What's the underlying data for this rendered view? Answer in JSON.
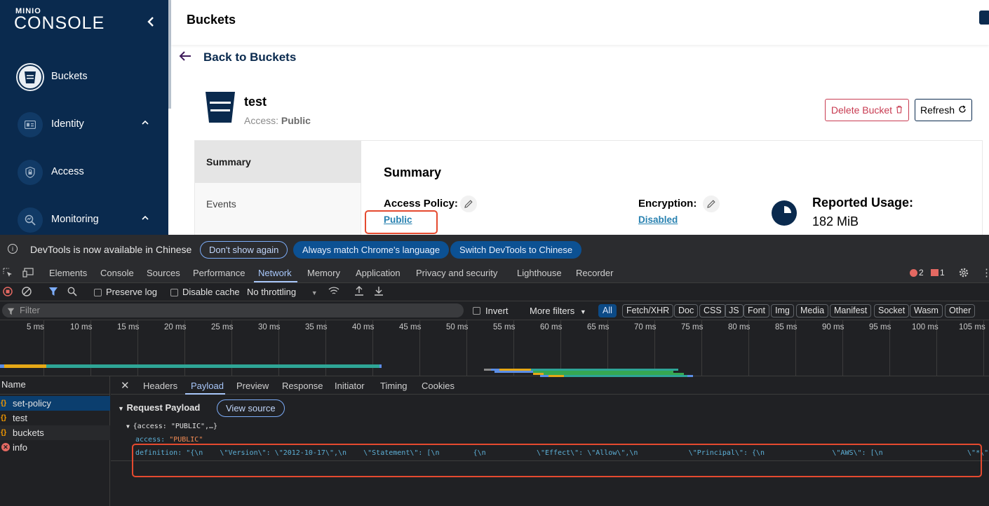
{
  "sidebar": {
    "logo_small": "MINIO",
    "logo_big": "CONSOLE",
    "items": [
      {
        "label": "Buckets"
      },
      {
        "label": "Identity"
      },
      {
        "label": "Access"
      },
      {
        "label": "Monitoring"
      }
    ]
  },
  "header": {
    "title": "Buckets",
    "back_label": "Back to Buckets"
  },
  "bucket": {
    "name": "test",
    "access_label": "Access:",
    "access_value": "Public",
    "delete_label": "Delete Bucket",
    "refresh_label": "Refresh"
  },
  "tabs": [
    "Summary",
    "Events"
  ],
  "summary": {
    "title": "Summary",
    "access_policy_label": "Access Policy:",
    "access_policy_value": "Public",
    "encryption_label": "Encryption:",
    "encryption_value": "Disabled",
    "usage_label": "Reported Usage:",
    "usage_value": "182 MiB"
  },
  "devtools": {
    "info_text": "DevTools is now available in Chinese",
    "btn_dont_show": "Don't show again",
    "btn_always_match": "Always match Chrome's language",
    "btn_switch": "Switch DevTools to Chinese",
    "main_tabs": [
      "Elements",
      "Console",
      "Sources",
      "Performance",
      "Network",
      "Memory",
      "Application",
      "Privacy and security",
      "Lighthouse",
      "Recorder"
    ],
    "error_count": "2",
    "issue_count": "1",
    "preserve_log": "Preserve log",
    "disable_cache": "Disable cache",
    "throttling": "No throttling",
    "filter_placeholder": "Filter",
    "invert": "Invert",
    "more_filters": "More filters",
    "filter_types": [
      "All",
      "Fetch/XHR",
      "Doc",
      "CSS",
      "JS",
      "Font",
      "Img",
      "Media",
      "Manifest",
      "Socket",
      "Wasm",
      "Other"
    ],
    "timeline_ticks": [
      "5 ms",
      "10 ms",
      "15 ms",
      "20 ms",
      "25 ms",
      "30 ms",
      "35 ms",
      "40 ms",
      "45 ms",
      "50 ms",
      "55 ms",
      "60 ms",
      "65 ms",
      "70 ms",
      "75 ms",
      "80 ms",
      "85 ms",
      "90 ms",
      "95 ms",
      "100 ms",
      "105 ms"
    ],
    "name_header": "Name",
    "requests": [
      {
        "name": "set-policy",
        "type": "xhr"
      },
      {
        "name": "test",
        "type": "xhr"
      },
      {
        "name": "buckets",
        "type": "xhr"
      },
      {
        "name": "info",
        "type": "error"
      }
    ],
    "detail_tabs": [
      "Headers",
      "Payload",
      "Preview",
      "Response",
      "Initiator",
      "Timing",
      "Cookies"
    ],
    "payload_title": "Request Payload",
    "view_source": "View source",
    "payload_summary": "{access: \"PUBLIC\",…}",
    "access_key": "access:",
    "access_val": "\"PUBLIC\"",
    "definition_line": "definition: \"{\\n    \\\"Version\\\": \\\"2012-10-17\\\",\\n    \\\"Statement\\\": [\\n        {\\n            \\\"Effect\\\": \\\"Allow\\\",\\n            \\\"Principal\\\": {\\n                \\\"AWS\\\": [\\n                    \\\"*\\\""
  },
  "colors": {
    "sidebar_bg": "#0a2a4e",
    "accent_link": "#2781b0",
    "danger": "#c83b51",
    "highlight_box": "#e54a2f",
    "devtools_bg": "#202124"
  }
}
